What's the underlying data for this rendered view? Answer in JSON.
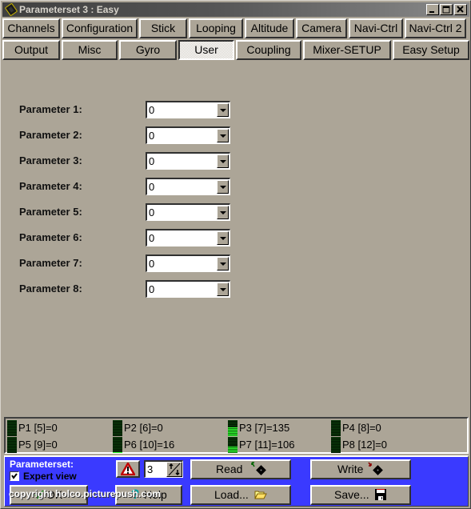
{
  "window": {
    "title": "Parameterset 3 : Easy",
    "controls": [
      "minimize",
      "maximize",
      "close"
    ]
  },
  "tabs_row1": [
    {
      "label": "Channels"
    },
    {
      "label": "Configuration"
    },
    {
      "label": "Stick"
    },
    {
      "label": "Looping"
    },
    {
      "label": "Altitude"
    },
    {
      "label": "Camera"
    },
    {
      "label": "Navi-Ctrl"
    },
    {
      "label": "Navi-Ctrl 2"
    }
  ],
  "tabs_row2": [
    {
      "label": "Output"
    },
    {
      "label": "Misc"
    },
    {
      "label": "Gyro"
    },
    {
      "label": "User",
      "active": true
    },
    {
      "label": "Coupling"
    },
    {
      "label": "Mixer-SETUP"
    },
    {
      "label": "Easy Setup"
    }
  ],
  "parameters": [
    {
      "label": "Parameter 1:",
      "value": "0"
    },
    {
      "label": "Parameter 2:",
      "value": "0"
    },
    {
      "label": "Parameter 3:",
      "value": "0"
    },
    {
      "label": "Parameter 4:",
      "value": "0"
    },
    {
      "label": "Parameter 5:",
      "value": "0"
    },
    {
      "label": "Parameter 6:",
      "value": "0"
    },
    {
      "label": "Parameter 7:",
      "value": "0"
    },
    {
      "label": "Parameter 8:",
      "value": "0"
    }
  ],
  "monitor": [
    {
      "text": "P1 [5]=0",
      "level": 0
    },
    {
      "text": "P2 [6]=0",
      "level": 0
    },
    {
      "text": "P3 [7]=135",
      "level": 0.53
    },
    {
      "text": "P4 [8]=0",
      "level": 0
    },
    {
      "text": "P5 [9]=0",
      "level": 0
    },
    {
      "text": "P6 [10]=16",
      "level": 0.06
    },
    {
      "text": "P7 [11]=106",
      "level": 0.42
    },
    {
      "text": "P8 [12]=0",
      "level": 0
    }
  ],
  "bottom": {
    "parameterset_label": "Parameterset:",
    "expert_view_label": "Expert view",
    "expert_view_checked": true,
    "parameterset_value": "3",
    "ok_label": "OK",
    "help_label": "Help",
    "read_label": "Read",
    "write_label": "Write",
    "load_label": "Load...",
    "save_label": "Save...",
    "accent_color": "#3a3aff"
  },
  "watermark": "copyright holco.picturepush.com"
}
